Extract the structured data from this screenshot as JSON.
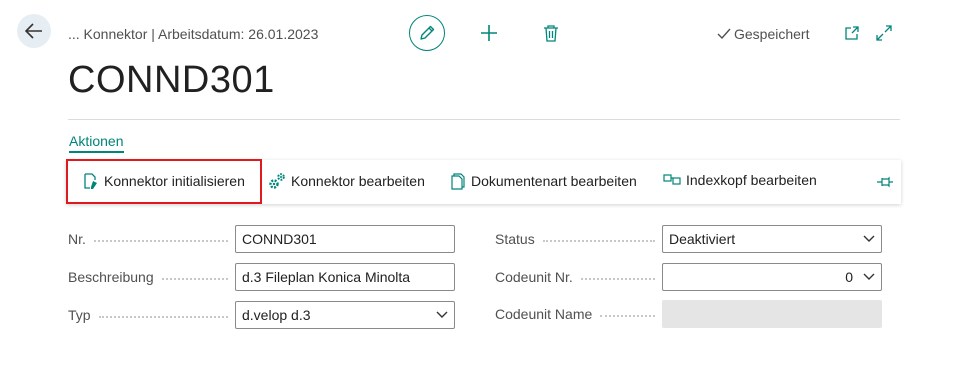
{
  "header": {
    "breadcrumb": "... Konnektor | Arbeitsdatum: 26.01.2023",
    "saved_status": "Gespeichert",
    "icons": [
      "back-arrow-icon",
      "edit-pencil-icon",
      "plus-icon",
      "trash-icon",
      "checkmark-icon",
      "open-new-window-icon",
      "expand-icon"
    ]
  },
  "page": {
    "title": "CONND301"
  },
  "tabs": {
    "actions_label": "Aktionen"
  },
  "actions": {
    "init": "Konnektor initialisieren",
    "edit_connector": "Konnektor bearbeiten",
    "edit_doctype": "Dokumentenart bearbeiten",
    "edit_indexhead": "Indexkopf bearbeiten"
  },
  "form": {
    "nr_label": "Nr.",
    "nr_value": "CONND301",
    "desc_label": "Beschreibung",
    "desc_value": "d.3 Fileplan Konica Minolta",
    "type_label": "Typ",
    "type_value": "d.velop d.3",
    "status_label": "Status",
    "status_value": "Deaktiviert",
    "codeunit_nr_label": "Codeunit Nr.",
    "codeunit_nr_value": "0",
    "codeunit_name_label": "Codeunit Name",
    "codeunit_name_value": ""
  },
  "colors": {
    "accent": "#00857a",
    "highlight": "#e0191d"
  }
}
